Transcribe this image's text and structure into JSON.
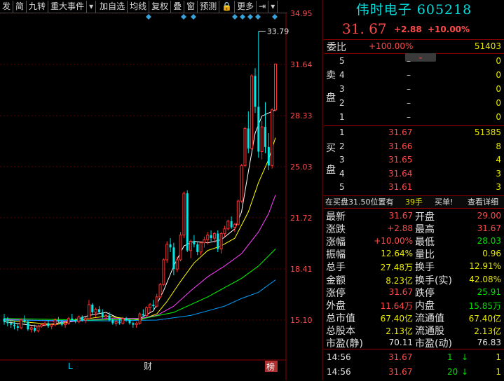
{
  "toolbar": {
    "items": [
      "发",
      "简",
      "九转",
      "重大事件",
      "▾",
      "加自选",
      "均线",
      "复权",
      "叠",
      "窗",
      "预测",
      "🔒",
      "更多",
      "⇥",
      "▾"
    ]
  },
  "chart": {
    "price_labels": [
      "34.95",
      "31.64",
      "28.33",
      "25.03",
      "21.72",
      "18.41",
      "15.10"
    ],
    "high_annotation": "33.79",
    "bottom_markers": {
      "l": "L",
      "cai": "财",
      "bang": "榜"
    },
    "colors": {
      "up": "#ff3030",
      "down": "#00e8e8",
      "ma5": "#ffffff",
      "ma10": "#ffff00",
      "ma20": "#ff40ff",
      "ma30": "#00ff00",
      "ma60": "#00a0ff"
    }
  },
  "chart_data": {
    "type": "candlestick",
    "ylim": [
      13.5,
      36.5
    ],
    "ticks": [
      34.95,
      31.64,
      28.33,
      25.03,
      21.72,
      18.41,
      15.1
    ],
    "candles": [
      [
        15.2,
        15.5,
        14.8,
        15.0
      ],
      [
        15.0,
        15.3,
        14.7,
        14.9
      ],
      [
        14.9,
        15.1,
        14.6,
        14.8
      ],
      [
        14.8,
        15.0,
        14.5,
        14.7
      ],
      [
        14.7,
        14.9,
        14.4,
        14.6
      ],
      [
        14.6,
        15.2,
        14.5,
        15.1
      ],
      [
        15.1,
        15.4,
        14.9,
        15.0
      ],
      [
        15.0,
        15.1,
        14.4,
        14.5
      ],
      [
        14.5,
        14.7,
        14.3,
        14.6
      ],
      [
        14.6,
        14.8,
        14.3,
        14.4
      ],
      [
        14.4,
        14.8,
        14.3,
        14.7
      ],
      [
        14.7,
        14.9,
        14.6,
        14.8
      ],
      [
        14.8,
        15.0,
        14.7,
        14.9
      ],
      [
        14.9,
        15.1,
        14.6,
        14.7
      ],
      [
        14.7,
        14.9,
        14.5,
        14.8
      ],
      [
        14.8,
        15.2,
        14.7,
        15.1
      ],
      [
        15.1,
        15.3,
        14.9,
        15.0
      ],
      [
        15.0,
        15.1,
        14.7,
        14.8
      ],
      [
        14.8,
        15.0,
        14.6,
        14.9
      ],
      [
        14.9,
        15.3,
        14.8,
        15.2
      ],
      [
        15.2,
        15.5,
        15.0,
        15.1
      ],
      [
        15.1,
        15.2,
        14.9,
        15.0
      ],
      [
        15.0,
        15.4,
        14.9,
        15.3
      ],
      [
        15.3,
        15.4,
        15.0,
        15.1
      ],
      [
        15.1,
        15.3,
        14.9,
        15.2
      ],
      [
        15.2,
        16.4,
        15.1,
        16.1
      ],
      [
        16.1,
        16.2,
        15.4,
        15.6
      ],
      [
        15.6,
        15.9,
        15.3,
        15.8
      ],
      [
        15.8,
        16.0,
        15.5,
        15.6
      ],
      [
        15.6,
        15.8,
        15.2,
        15.3
      ],
      [
        15.3,
        15.5,
        15.1,
        15.4
      ],
      [
        15.4,
        15.6,
        15.0,
        15.1
      ],
      [
        15.1,
        15.2,
        14.8,
        14.9
      ],
      [
        14.9,
        15.1,
        14.7,
        15.0
      ],
      [
        15.0,
        15.2,
        14.8,
        14.9
      ],
      [
        14.9,
        15.3,
        14.8,
        15.2
      ],
      [
        15.2,
        15.3,
        15.0,
        15.1
      ],
      [
        15.1,
        15.2,
        14.8,
        14.9
      ],
      [
        14.9,
        15.0,
        14.6,
        14.8
      ],
      [
        14.8,
        15.0,
        14.6,
        14.9
      ],
      [
        14.9,
        15.6,
        14.8,
        15.5
      ],
      [
        15.5,
        15.8,
        15.3,
        15.4
      ],
      [
        15.4,
        16.0,
        15.3,
        15.9
      ],
      [
        15.9,
        16.2,
        15.6,
        16.1
      ],
      [
        16.1,
        16.4,
        15.8,
        16.0
      ],
      [
        16.0,
        16.8,
        15.9,
        16.6
      ],
      [
        16.6,
        17.5,
        16.5,
        17.4
      ],
      [
        17.4,
        19.1,
        17.3,
        19.0
      ],
      [
        19.0,
        20.2,
        18.8,
        20.0
      ],
      [
        20.0,
        20.4,
        19.5,
        19.8
      ],
      [
        19.8,
        20.1,
        18.0,
        18.4
      ],
      [
        18.4,
        19.2,
        18.2,
        19.0
      ],
      [
        19.0,
        20.8,
        18.9,
        20.6
      ],
      [
        20.6,
        23.4,
        20.4,
        23.3
      ],
      [
        23.3,
        23.5,
        19.5,
        19.6
      ],
      [
        19.6,
        20.3,
        19.1,
        20.2
      ],
      [
        20.2,
        20.6,
        19.8,
        20.0
      ],
      [
        20.0,
        20.2,
        19.3,
        19.5
      ],
      [
        19.5,
        20.2,
        19.3,
        20.1
      ],
      [
        20.1,
        20.5,
        19.8,
        20.3
      ],
      [
        20.3,
        20.8,
        20.0,
        20.6
      ],
      [
        20.6,
        20.9,
        20.2,
        20.4
      ],
      [
        20.4,
        20.8,
        20.1,
        20.7
      ],
      [
        20.7,
        20.9,
        19.5,
        19.7
      ],
      [
        19.7,
        20.8,
        19.4,
        20.7
      ],
      [
        20.7,
        21.2,
        20.5,
        21.0
      ],
      [
        21.0,
        21.6,
        20.9,
        21.5
      ],
      [
        21.5,
        21.8,
        21.0,
        21.1
      ],
      [
        21.1,
        21.4,
        20.8,
        21.3
      ],
      [
        21.3,
        22.9,
        21.2,
        22.8
      ],
      [
        22.8,
        25.2,
        22.7,
        25.1
      ],
      [
        25.1,
        27.6,
        25.0,
        27.5
      ],
      [
        27.5,
        28.6,
        25.9,
        26.2
      ],
      [
        26.2,
        31.0,
        26.1,
        30.9
      ],
      [
        30.9,
        31.4,
        28.5,
        28.9
      ],
      [
        28.9,
        33.79,
        25.6,
        26.0
      ],
      [
        26.0,
        28.0,
        25.5,
        27.6
      ],
      [
        27.6,
        29.2,
        25.9,
        26.3
      ],
      [
        26.3,
        27.2,
        24.8,
        25.1
      ],
      [
        25.1,
        28.8,
        24.9,
        28.7
      ],
      [
        28.7,
        31.7,
        28.6,
        31.67
      ]
    ],
    "ma": [
      {
        "name": "MA5",
        "color": "#ffffff",
        "values": [
          [
            0,
            15.0
          ],
          [
            10,
            14.7
          ],
          [
            20,
            15.05
          ],
          [
            25,
            15.4
          ],
          [
            30,
            15.6
          ],
          [
            35,
            15.1
          ],
          [
            40,
            15.2
          ],
          [
            44,
            15.7
          ],
          [
            47,
            17.0
          ],
          [
            50,
            18.6
          ],
          [
            53,
            19.9
          ],
          [
            56,
            20.2
          ],
          [
            60,
            20.1
          ],
          [
            64,
            20.3
          ],
          [
            68,
            21.0
          ],
          [
            70,
            22.1
          ],
          [
            72,
            24.7
          ],
          [
            74,
            27.2
          ],
          [
            76,
            28.3
          ],
          [
            78,
            28.5
          ],
          [
            80,
            28.7
          ]
        ]
      },
      {
        "name": "MA10",
        "color": "#ffff00",
        "values": [
          [
            0,
            15.1
          ],
          [
            15,
            14.8
          ],
          [
            25,
            15.2
          ],
          [
            30,
            15.35
          ],
          [
            40,
            15.1
          ],
          [
            45,
            15.5
          ],
          [
            48,
            16.3
          ],
          [
            52,
            17.6
          ],
          [
            56,
            18.8
          ],
          [
            60,
            19.6
          ],
          [
            64,
            19.9
          ],
          [
            68,
            20.4
          ],
          [
            72,
            22.1
          ],
          [
            75,
            24.0
          ],
          [
            78,
            25.5
          ],
          [
            80,
            26.9
          ]
        ]
      },
      {
        "name": "MA20",
        "color": "#ff40ff",
        "values": [
          [
            0,
            15.15
          ],
          [
            20,
            15.0
          ],
          [
            30,
            15.2
          ],
          [
            40,
            15.2
          ],
          [
            45,
            15.4
          ],
          [
            50,
            16.0
          ],
          [
            55,
            17.0
          ],
          [
            60,
            17.9
          ],
          [
            65,
            18.6
          ],
          [
            70,
            19.4
          ],
          [
            75,
            20.8
          ],
          [
            78,
            22.0
          ],
          [
            80,
            23.2
          ]
        ]
      },
      {
        "name": "MA30",
        "color": "#00ff00",
        "values": [
          [
            0,
            15.2
          ],
          [
            25,
            15.1
          ],
          [
            40,
            15.15
          ],
          [
            50,
            15.6
          ],
          [
            55,
            16.1
          ],
          [
            60,
            16.6
          ],
          [
            65,
            17.2
          ],
          [
            70,
            17.8
          ],
          [
            75,
            18.6
          ],
          [
            80,
            19.7
          ]
        ]
      },
      {
        "name": "MA60",
        "color": "#00a0ff",
        "values": [
          [
            0,
            15.1
          ],
          [
            30,
            15.05
          ],
          [
            45,
            15.1
          ],
          [
            55,
            15.4
          ],
          [
            60,
            15.7
          ],
          [
            65,
            16.0
          ],
          [
            70,
            16.5
          ],
          [
            75,
            16.9
          ],
          [
            80,
            17.7
          ]
        ]
      }
    ]
  },
  "panel": {
    "title": "伟时电子 605218",
    "price": "31. 67",
    "change": "+2.88",
    "change_pct": "+10.00%",
    "weibi_label": "委比",
    "weibi_value": "+100.00%",
    "weibi_volume": "51403",
    "sell_side_label": [
      "卖",
      "盘"
    ],
    "buy_side_label": [
      "买",
      "盘"
    ],
    "sells": [
      {
        "level": "5",
        "price": "–",
        "vol": "0"
      },
      {
        "level": "4",
        "price": "–",
        "vol": "0"
      },
      {
        "level": "3",
        "price": "–",
        "vol": "0"
      },
      {
        "level": "2",
        "price": "–",
        "vol": "0"
      },
      {
        "level": "1",
        "price": "–",
        "vol": "0"
      }
    ],
    "buys": [
      {
        "level": "1",
        "price": "31.67",
        "vol": "51385"
      },
      {
        "level": "2",
        "price": "31.66",
        "vol": "8"
      },
      {
        "level": "3",
        "price": "31.65",
        "vol": "4"
      },
      {
        "level": "4",
        "price": "31.64",
        "vol": "3"
      },
      {
        "level": "5",
        "price": "31.61",
        "vol": "3"
      }
    ],
    "status": {
      "left": "在买盘31.50位置有",
      "hands": "39手",
      "buy": "买单!",
      "detail": "查看详细"
    },
    "stats": [
      {
        "l1": "最新",
        "v1": "31.67",
        "c1": "red",
        "l2": "开盘",
        "v2": "29.00",
        "c2": "red"
      },
      {
        "l1": "涨跌",
        "v1": "+2.88",
        "c1": "red",
        "l2": "最高",
        "v2": "31.67",
        "c2": "red"
      },
      {
        "l1": "涨幅",
        "v1": "+10.00%",
        "c1": "red",
        "l2": "最低",
        "v2": "28.03",
        "c2": "green"
      },
      {
        "l1": "振幅",
        "v1": "12.64%",
        "c1": "yellow",
        "l2": "量比",
        "v2": "0.96",
        "c2": "yellow"
      },
      {
        "l1": "总手",
        "v1": "27.48万",
        "c1": "yellow",
        "l2": "换手",
        "v2": "12.91%",
        "c2": "yellow"
      },
      {
        "l1": "金额",
        "v1": "8.23亿",
        "c1": "yellow",
        "l2": "换手(实)",
        "v2": "42.08%",
        "c2": "yellow"
      },
      {
        "l1": "涨停",
        "v1": "31.67",
        "c1": "red",
        "l2": "跌停",
        "v2": "25.91",
        "c2": "green"
      },
      {
        "l1": "外盘",
        "v1": "11.64万",
        "c1": "red",
        "l2": "内盘",
        "v2": "15.85万",
        "c2": "green"
      },
      {
        "l1": "总市值",
        "v1": "67.40亿",
        "c1": "yellow",
        "l2": "流通值",
        "v2": "67.40亿",
        "c2": "yellow"
      },
      {
        "l1": "总股本",
        "v1": "2.13亿",
        "c1": "yellow",
        "l2": "流通股",
        "v2": "2.13亿",
        "c2": "yellow"
      },
      {
        "l1": "市盈(静)",
        "v1": "70.11",
        "c1": "white",
        "l2": "市盈(动)",
        "v2": "76.83",
        "c2": "white"
      }
    ],
    "trades": [
      {
        "time": "14:56",
        "price": "31.67",
        "vol": "1",
        "arrow": "↓",
        "num": "1"
      },
      {
        "time": "14:56",
        "price": "31.67",
        "vol": "20",
        "arrow": "↓",
        "num": "1"
      }
    ]
  }
}
